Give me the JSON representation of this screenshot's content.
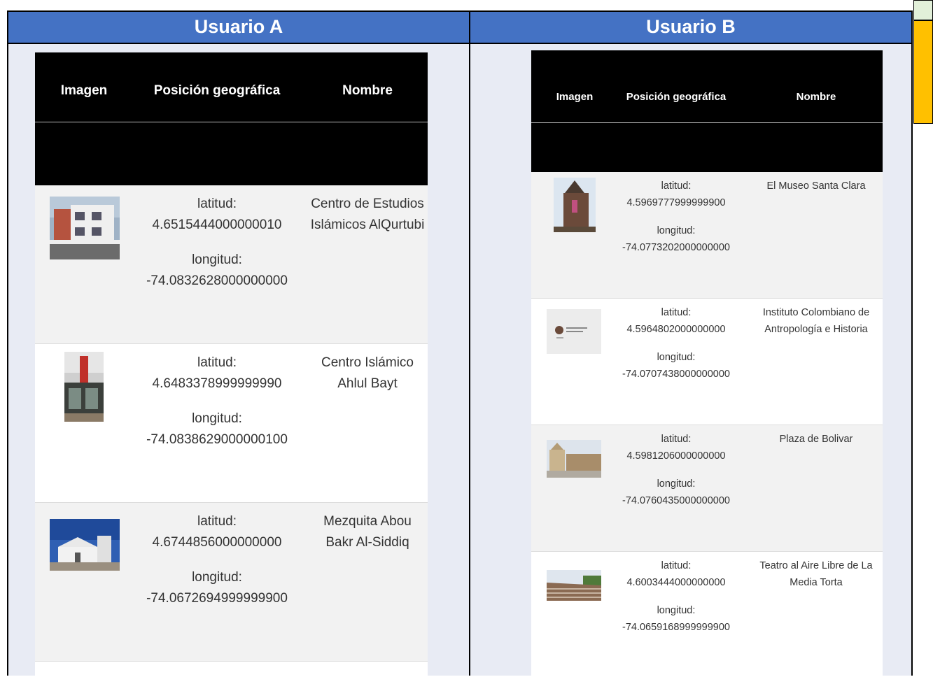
{
  "panels": {
    "a": {
      "title": "Usuario A",
      "headers": {
        "image": "Imagen",
        "position": "Posición geográfica",
        "name": "Nombre"
      },
      "rows": [
        {
          "lat_label": "latitud:",
          "lat": "4.6515444000000010",
          "lon_label": "longitud:",
          "lon": "-74.0832628000000000",
          "name": "Centro de Estudios Islámicos AlQurtubi",
          "image": "white-building-photo"
        },
        {
          "lat_label": "latitud:",
          "lat": "4.6483378999999990",
          "lon_label": "longitud:",
          "lon": "-74.0838629000000100",
          "name": "Centro Islámico Ahlul Bayt",
          "image": "storefront-photo"
        },
        {
          "lat_label": "latitud:",
          "lat": "4.6744856000000000",
          "lon_label": "longitud:",
          "lon": "-74.0672694999999900",
          "name": "Mezquita Abou Bakr Al-Siddiq",
          "image": "mosque-photo"
        }
      ]
    },
    "b": {
      "title": "Usuario B",
      "headers": {
        "image": "Imagen",
        "position": "Posición geográfica",
        "name": "Nombre"
      },
      "rows": [
        {
          "lat_label": "latitud:",
          "lat": "4.5969777999999900",
          "lon_label": "longitud:",
          "lon": "-74.0773202000000000",
          "name": "El Museo Santa Clara",
          "image": "church-tower-photo"
        },
        {
          "lat_label": "latitud:",
          "lat": "4.5964802000000000",
          "lon_label": "longitud:",
          "lon": "-74.0707438000000000",
          "name": "Instituto Colombiano de Antropología e Historia",
          "image": "institute-logo"
        },
        {
          "lat_label": "latitud:",
          "lat": "4.5981206000000000",
          "lon_label": "longitud:",
          "lon": "-74.0760435000000000",
          "name": "Plaza de Bolivar",
          "image": "plaza-photo"
        },
        {
          "lat_label": "latitud:",
          "lat": "4.6003444000000000",
          "lon_label": "longitud:",
          "lon": "-74.0659168999999900",
          "name": "Teatro al Aire Libre de La Media Torta",
          "image": "amphitheater-photo"
        }
      ]
    }
  },
  "colors": {
    "header_blue": "#4472c4",
    "panel_bg": "#e8ebf4",
    "side_green": "#e2f0d9",
    "side_yellow": "#ffc000"
  }
}
